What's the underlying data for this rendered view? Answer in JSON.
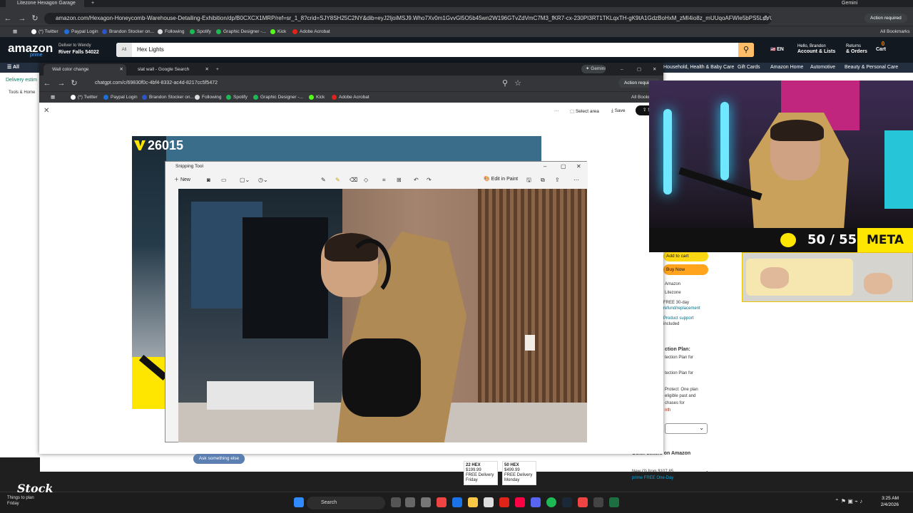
{
  "outer_browser": {
    "tab_title": "Litezone Hexagon Garage Light",
    "gemini_label": "Gemini",
    "url": "amazon.com/Hexagon-Honeycomb-Warehouse-Detailing-Exhibition/dp/B0CXCX1MRP/ref=sr_1_8?crid=SJY8SH25C2NY&dib=eyJ2IjoiMSJ9.Who7Xv0m1GvvGl5O5b45wn2W196GTvZdVmC7M3_fKR7-cx-230PI3RT1TKLqxTH-gK9tA1GdzBoHxM_zMI4io8z_mUUqoAFWIe5bPS5LdVC7guhpg-Y43QJHxU4MnZbTa4uOt_Chc0dj...",
    "action_required": "Action required",
    "bookmarks": [
      "(*) Twitter",
      "Paypal Login",
      "Brandon Stocker on...",
      "Following",
      "Spotify",
      "Graphic Designer -...",
      "Kick",
      "Adobe Acrobat"
    ],
    "all_bookmarks": "All Bookmarks"
  },
  "amazon": {
    "logo": "amazon",
    "prime": "prime",
    "deliver_line1": "Deliver to Wendy",
    "deliver_line2": "River Falls 54022",
    "search_dept": "All",
    "search_query": "Hex Lights",
    "lang": "EN",
    "account_line1": "Hello, Brandon",
    "account_line2": "Account & Lists",
    "returns_line1": "Returns",
    "returns_line2": "& Orders",
    "cart_label": "Cart",
    "cart_count": "0",
    "nav_all": "All",
    "nav_items": [
      "Household, Health & Baby Care",
      "Gift Cards",
      "Amazon Home",
      "Automotive",
      "Beauty & Personal Care"
    ],
    "left_text1": "Delivery estim",
    "left_text2": "Tools & Home",
    "add_to_cart": "Add to cart",
    "buy_now": "Buy Now",
    "right_texts": [
      "Amazon",
      "Litezone",
      "FREE 30-day",
      "refund/replacement",
      "Product support",
      "included",
      "ction Plan:",
      "tection Plan for",
      "tection Plan for",
      "Protect: One plan",
      "eligible past and",
      "chases for",
      "nth"
    ],
    "other_sellers": "Other sellers on Amazon",
    "new_from": "New (3) from $107.85",
    "prime_delivery": "prime FREE One-Day",
    "hex_cards": [
      {
        "title": "22 HEX",
        "price": "$199.99",
        "delivery": "FREE Delivery",
        "day": "Friday"
      },
      {
        "title": "50 HEX",
        "price": "$499.99",
        "delivery": "FREE Delivery",
        "day": "Monday"
      }
    ]
  },
  "chatgpt_window": {
    "tabs": [
      "Wall color change",
      "slat wall - Google Search"
    ],
    "gemini_label": "Gemini",
    "url": "chatgpt.com/c/69830f0c-4bf4-8332-ac4d-8217cc5f5472",
    "action_required": "Action required",
    "bookmarks": [
      "(*) Twitter",
      "Paypal Login",
      "Brandon Stocker on...",
      "Following",
      "Spotify",
      "Graphic Designer -...",
      "Kick",
      "Adobe Acrobat"
    ],
    "all_bookmarks": "All Bookm",
    "toolbar": {
      "more": "···",
      "select_area": "Select area",
      "save": "Save",
      "share": "S"
    },
    "image_number": "26015",
    "ask_something": "Ask something else"
  },
  "snipping_tool": {
    "title": "Snipping Tool",
    "new_label": "New",
    "edit_in_paint": "Edit in Paint"
  },
  "stream_overlay": {
    "score": "50 / 55",
    "brand": "META",
    "logo": "Stock"
  },
  "taskbar": {
    "search": "Search",
    "time": "3:25 AM",
    "date": "2/4/2026",
    "notification": "Things to plan",
    "notification_sub": "Friday"
  },
  "colors": {
    "amazon_dark": "#131921",
    "amazon_nav": "#232f3e",
    "amazon_search_btn": "#febd69",
    "amazon_cart_btn": "#ffd814",
    "amazon_buy_btn": "#ffa41c",
    "overlay_yellow": "#ffe600"
  }
}
